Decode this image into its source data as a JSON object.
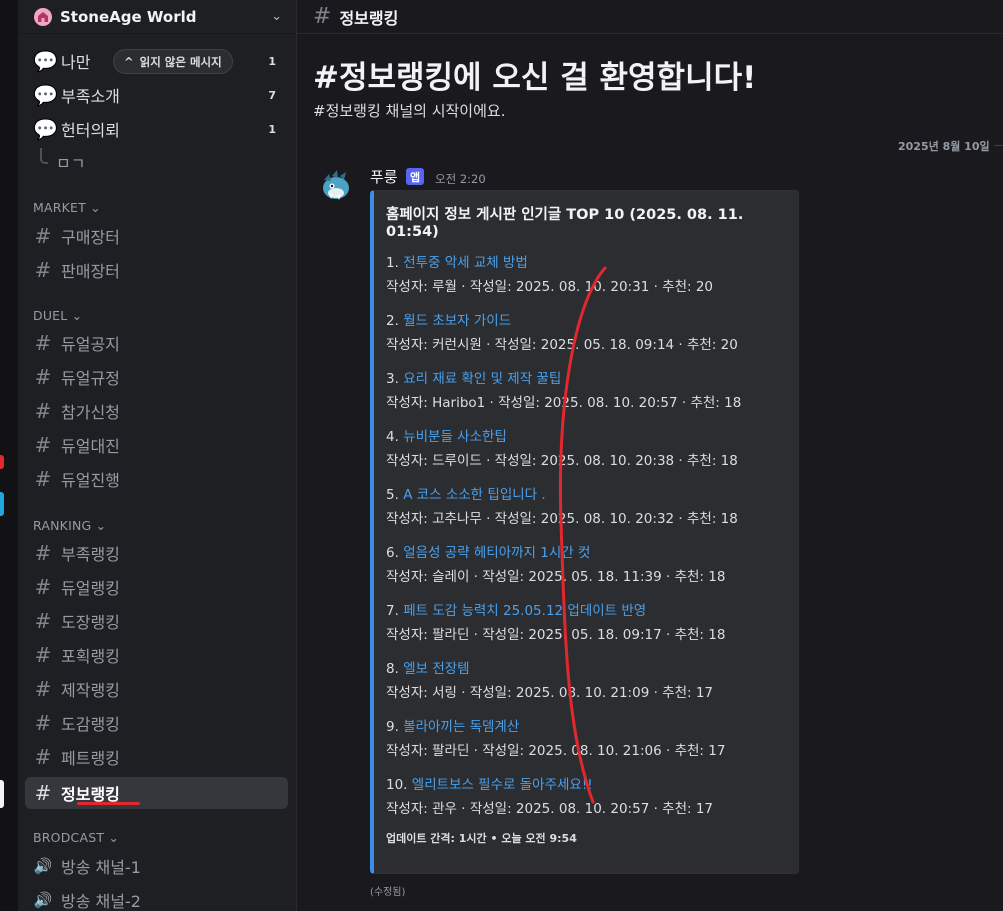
{
  "server": {
    "name": "StoneAge World"
  },
  "sidebar": {
    "unread_pill": "읽지 않은 메시지",
    "top_channels": [
      {
        "label": "나만",
        "count": "1"
      },
      {
        "label": "부족소개",
        "count": "7"
      },
      {
        "label": "헌터의뢰",
        "count": "1"
      },
      {
        "label": "ㅁㄱ"
      }
    ],
    "categories": {
      "market": "MARKET",
      "duel": "DUEL",
      "ranking": "RANKING",
      "broadcast": "BRODCAST"
    },
    "market": [
      "구매장터",
      "판매장터"
    ],
    "duel": [
      "듀얼공지",
      "듀얼규정",
      "참가신청",
      "듀얼대진",
      "듀얼진행"
    ],
    "ranking": [
      "부족랭킹",
      "듀얼랭킹",
      "도장랭킹",
      "포획랭킹",
      "제작랭킹",
      "도감랭킹",
      "페트랭킹",
      "정보랭킹"
    ],
    "broadcast": [
      "방송 채널-1",
      "방송 채널-2"
    ]
  },
  "channel": {
    "name": "정보랭킹",
    "welcome_title": "#정보랭킹에 오신 걸 환영합니다!",
    "welcome_sub": "#정보랭킹 채널의 시작이에요."
  },
  "date_divider": "2025년 8월 10일",
  "message": {
    "author": "푸룽",
    "badge": "앱",
    "time": "오전 2:20",
    "edited": "(수정됨)",
    "embed": {
      "title": "홈페이지 정보 게시판 인기글 TOP 10 (2025. 08. 11. 01:54)",
      "entries": [
        {
          "rank": "1.",
          "title": "전투중 악세 교체 방법",
          "meta": "작성자: 루월 · 작성일: 2025. 08. 10. 20:31 · 추천: 20"
        },
        {
          "rank": "2.",
          "title": "월드 초보자 가이드",
          "meta": "작성자: 커런시원 · 작성일: 2025. 05. 18. 09:14 · 추천: 20"
        },
        {
          "rank": "3.",
          "title": "요리 재료 확인 및 제작 꿀팁",
          "meta": "작성자: Haribo1 · 작성일: 2025. 08. 10. 20:57 · 추천: 18"
        },
        {
          "rank": "4.",
          "title": "뉴비분들 사소한팁",
          "meta": "작성자: 드루이드 · 작성일: 2025. 08. 10. 20:38 · 추천: 18"
        },
        {
          "rank": "5.",
          "title": "A 코스 소소한 팁입니다 .",
          "meta": "작성자: 고추나무 · 작성일: 2025. 08. 10. 20:32 · 추천: 18"
        },
        {
          "rank": "6.",
          "title": "얼음성 공략 헤티아까지 1시간 컷",
          "meta": "작성자: 슬레이 · 작성일: 2025. 05. 18. 11:39 · 추천: 18"
        },
        {
          "rank": "7.",
          "title": "페트 도감 능력치 25.05.12 업데이트 반영",
          "meta": "작성자: 팔라딘 · 작성일: 2025. 05. 18. 09:17 · 추천: 18"
        },
        {
          "rank": "8.",
          "title": "엘보 전장템",
          "meta": "작성자: 서링 · 작성일: 2025. 08. 10. 21:09 · 추천: 17"
        },
        {
          "rank": "9.",
          "title": "볼라아끼는 독뎀계산",
          "meta": "작성자: 팔라딘 · 작성일: 2025. 08. 10. 21:06 · 추천: 17"
        },
        {
          "rank": "10.",
          "title": "엘리트보스 필수로 돌아주세요!!",
          "meta": "작성자: 관우 · 작성일: 2025. 08. 10. 20:57 · 추천: 17"
        }
      ],
      "footer": "업데이트 간격: 1시간 • 오늘 오전 9:54"
    }
  },
  "colors": {
    "link": "#4aa0ec",
    "embed_accent": "#3a8ee6",
    "annotation": "#e0282e",
    "badge": "#5865f2"
  }
}
